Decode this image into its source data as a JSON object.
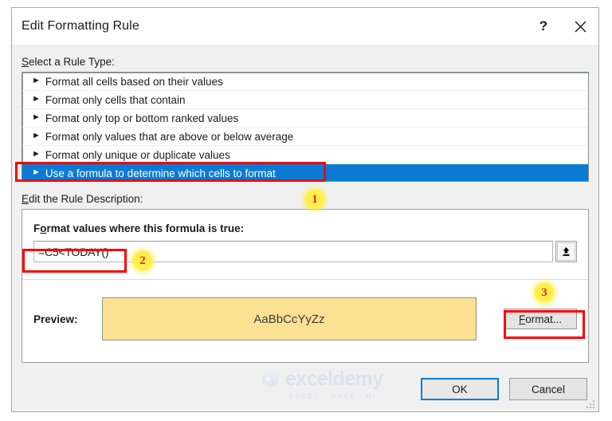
{
  "dialog": {
    "title": "Edit Formatting Rule",
    "help_icon": "question-mark-icon",
    "help_label": "?",
    "close_icon": "close-icon"
  },
  "rule_type": {
    "label": "Select a Rule Type:",
    "label_accel": "S",
    "label_rest": "elect a Rule Type:",
    "items": [
      {
        "text": "Format all cells based on their values",
        "selected": false
      },
      {
        "text": "Format only cells that contain",
        "selected": false
      },
      {
        "text": "Format only top or bottom ranked values",
        "selected": false
      },
      {
        "text": "Format only values that are above or below average",
        "selected": false
      },
      {
        "text": "Format only unique or duplicate values",
        "selected": false
      },
      {
        "text": "Use a formula to determine which cells to format",
        "selected": true
      }
    ],
    "bullet_glyph": "►",
    "selected_color": "#0a7bd4"
  },
  "description": {
    "label": "Edit the Rule Description:",
    "label_accel": "E",
    "label_rest": "dit the Rule Description:",
    "formula_label_accel": "o",
    "formula_label_pre": "F",
    "formula_label_post": "rmat values where this formula is true:",
    "formula_label": "Format values where this formula is true:",
    "formula_value": "=C5<TODAY()",
    "range_button_icon": "collapse-dialog-up-arrow-icon",
    "preview_label": "Preview:",
    "preview_text": "AaBbCcYyZz",
    "preview_fill": "#fde193",
    "format_button_accel": "F",
    "format_button_rest": "ormat...",
    "format_button": "Format..."
  },
  "footer": {
    "ok_label": "OK",
    "cancel_label": "Cancel",
    "default_button_color": "#0a7bd4"
  },
  "watermark": {
    "brand": "exceldemy",
    "tagline": "EXCEL  ·  DATA  ·  BI",
    "logo_icon": "exceldemy-cube-logo-icon"
  },
  "annotations": {
    "badge_1": "1",
    "badge_2": "2",
    "badge_3": "3",
    "box_color": "#ff0000"
  }
}
